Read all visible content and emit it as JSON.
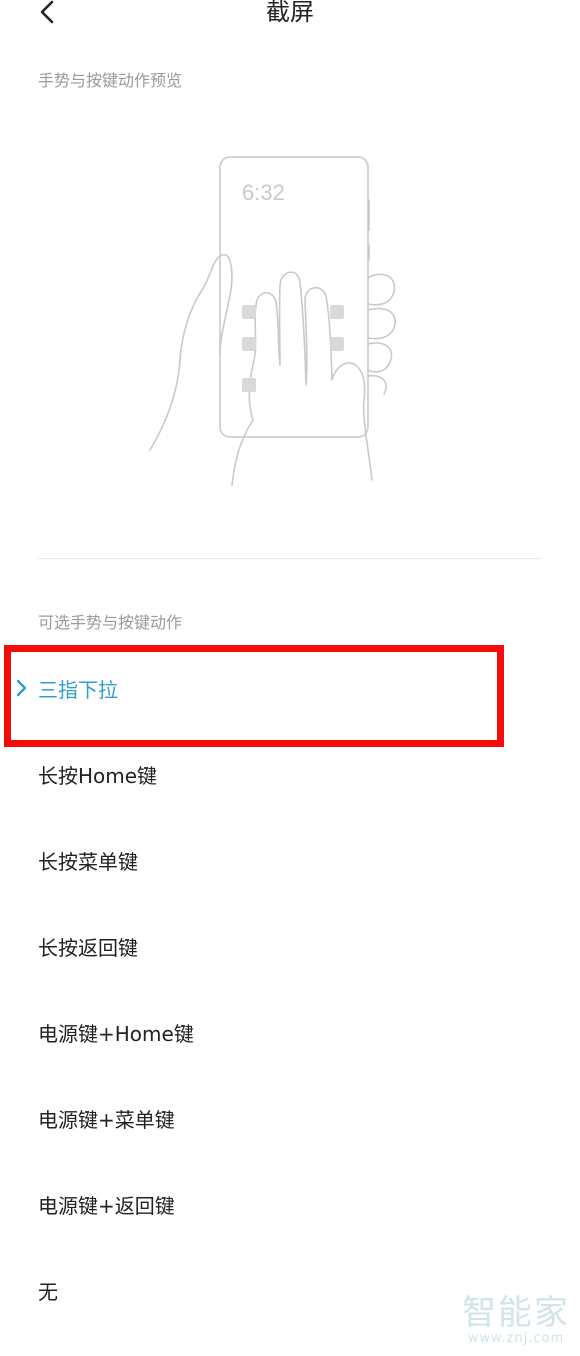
{
  "header": {
    "title": "截屏"
  },
  "preview": {
    "section_label": "手势与按键动作预览",
    "time": "6:32"
  },
  "options": {
    "section_label": "可选手势与按键动作",
    "items": [
      {
        "label": "三指下拉",
        "selected": true
      },
      {
        "label": "长按Home键",
        "selected": false
      },
      {
        "label": "长按菜单键",
        "selected": false
      },
      {
        "label": "长按返回键",
        "selected": false
      },
      {
        "label": "电源键+Home键",
        "selected": false
      },
      {
        "label": "电源键+菜单键",
        "selected": false
      },
      {
        "label": "电源键+返回键",
        "selected": false
      },
      {
        "label": "无",
        "selected": false
      }
    ]
  },
  "watermark": {
    "main": "智能家",
    "sub": "www.znj.com"
  },
  "colors": {
    "accent": "#2fa0c9",
    "highlight": "#f40c0c",
    "text": "#222222",
    "muted": "#9a9a9a"
  }
}
